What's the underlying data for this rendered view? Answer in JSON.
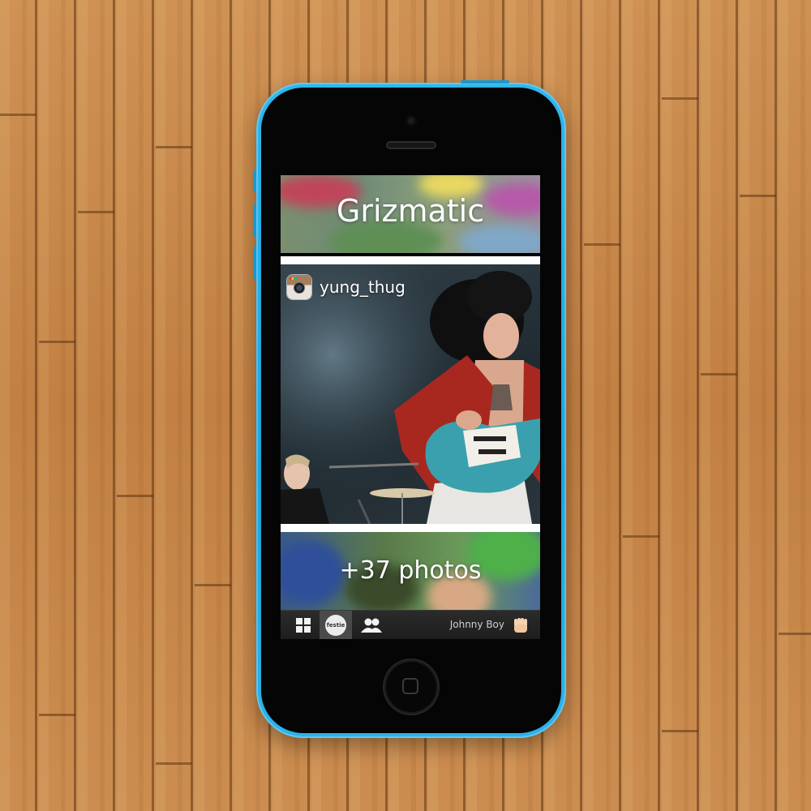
{
  "app": {
    "banner_title": "Grizmatic",
    "post": {
      "source_icon": "instagram-icon",
      "username": "yung_thug"
    },
    "more_photos_label": "+37 photos",
    "tabbar": {
      "tabs": [
        {
          "icon": "grid-icon",
          "active": false
        },
        {
          "icon": "festie-logo-icon",
          "label": "festie",
          "active": true
        },
        {
          "icon": "people-icon",
          "active": false
        }
      ],
      "user_name": "Johnny Boy",
      "user_icon": "fist-icon"
    }
  },
  "colors": {
    "phone_case": "#1aa6e2",
    "background_wood": "#c98a4c",
    "tabbar": "#1e1e1e",
    "active_tab": "#4a4a4a"
  }
}
